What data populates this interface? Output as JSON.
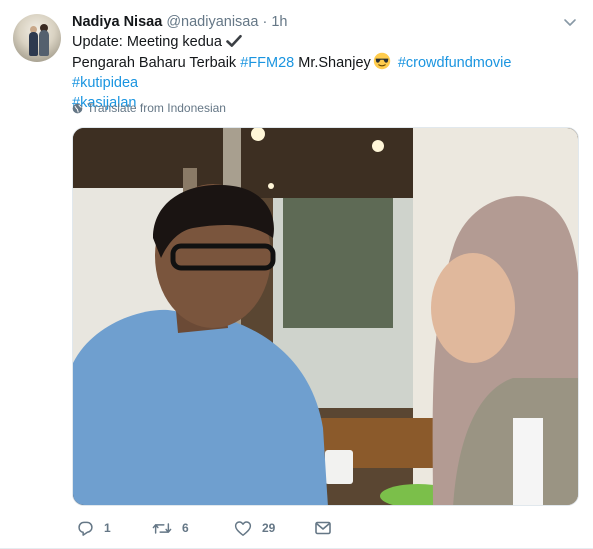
{
  "tweet": {
    "author_name": "Nadiya Nisaa",
    "handle": "@nadiyanisaa",
    "separator": "·",
    "time": "1h",
    "line1": "Update: Meeting kedua",
    "line2_text": "Pengarah Baharu Terbaik",
    "hashtag_ffm28": "#FFM28",
    "mention_text": "Mr.Shanjey",
    "hashtag_crowdfund": "#crowdfundmovie",
    "hashtag_kutipidea": "#kutipidea",
    "hashtag_kasijalan": "#kasijalan",
    "translate": "Translate from Indonesian"
  },
  "actions": {
    "reply_count": "1",
    "retweet_count": "6",
    "like_count": "29"
  },
  "colors": {
    "link": "#1b95e0",
    "muted": "#657786",
    "text": "#14171a"
  },
  "icons": {
    "caret": "chevron-down-icon",
    "check": "heavy-check-mark-icon",
    "emoji": "sunglasses-emoji-icon",
    "globe": "globe-icon",
    "reply": "reply-icon",
    "retweet": "retweet-icon",
    "like": "heart-icon",
    "dm": "envelope-icon"
  }
}
